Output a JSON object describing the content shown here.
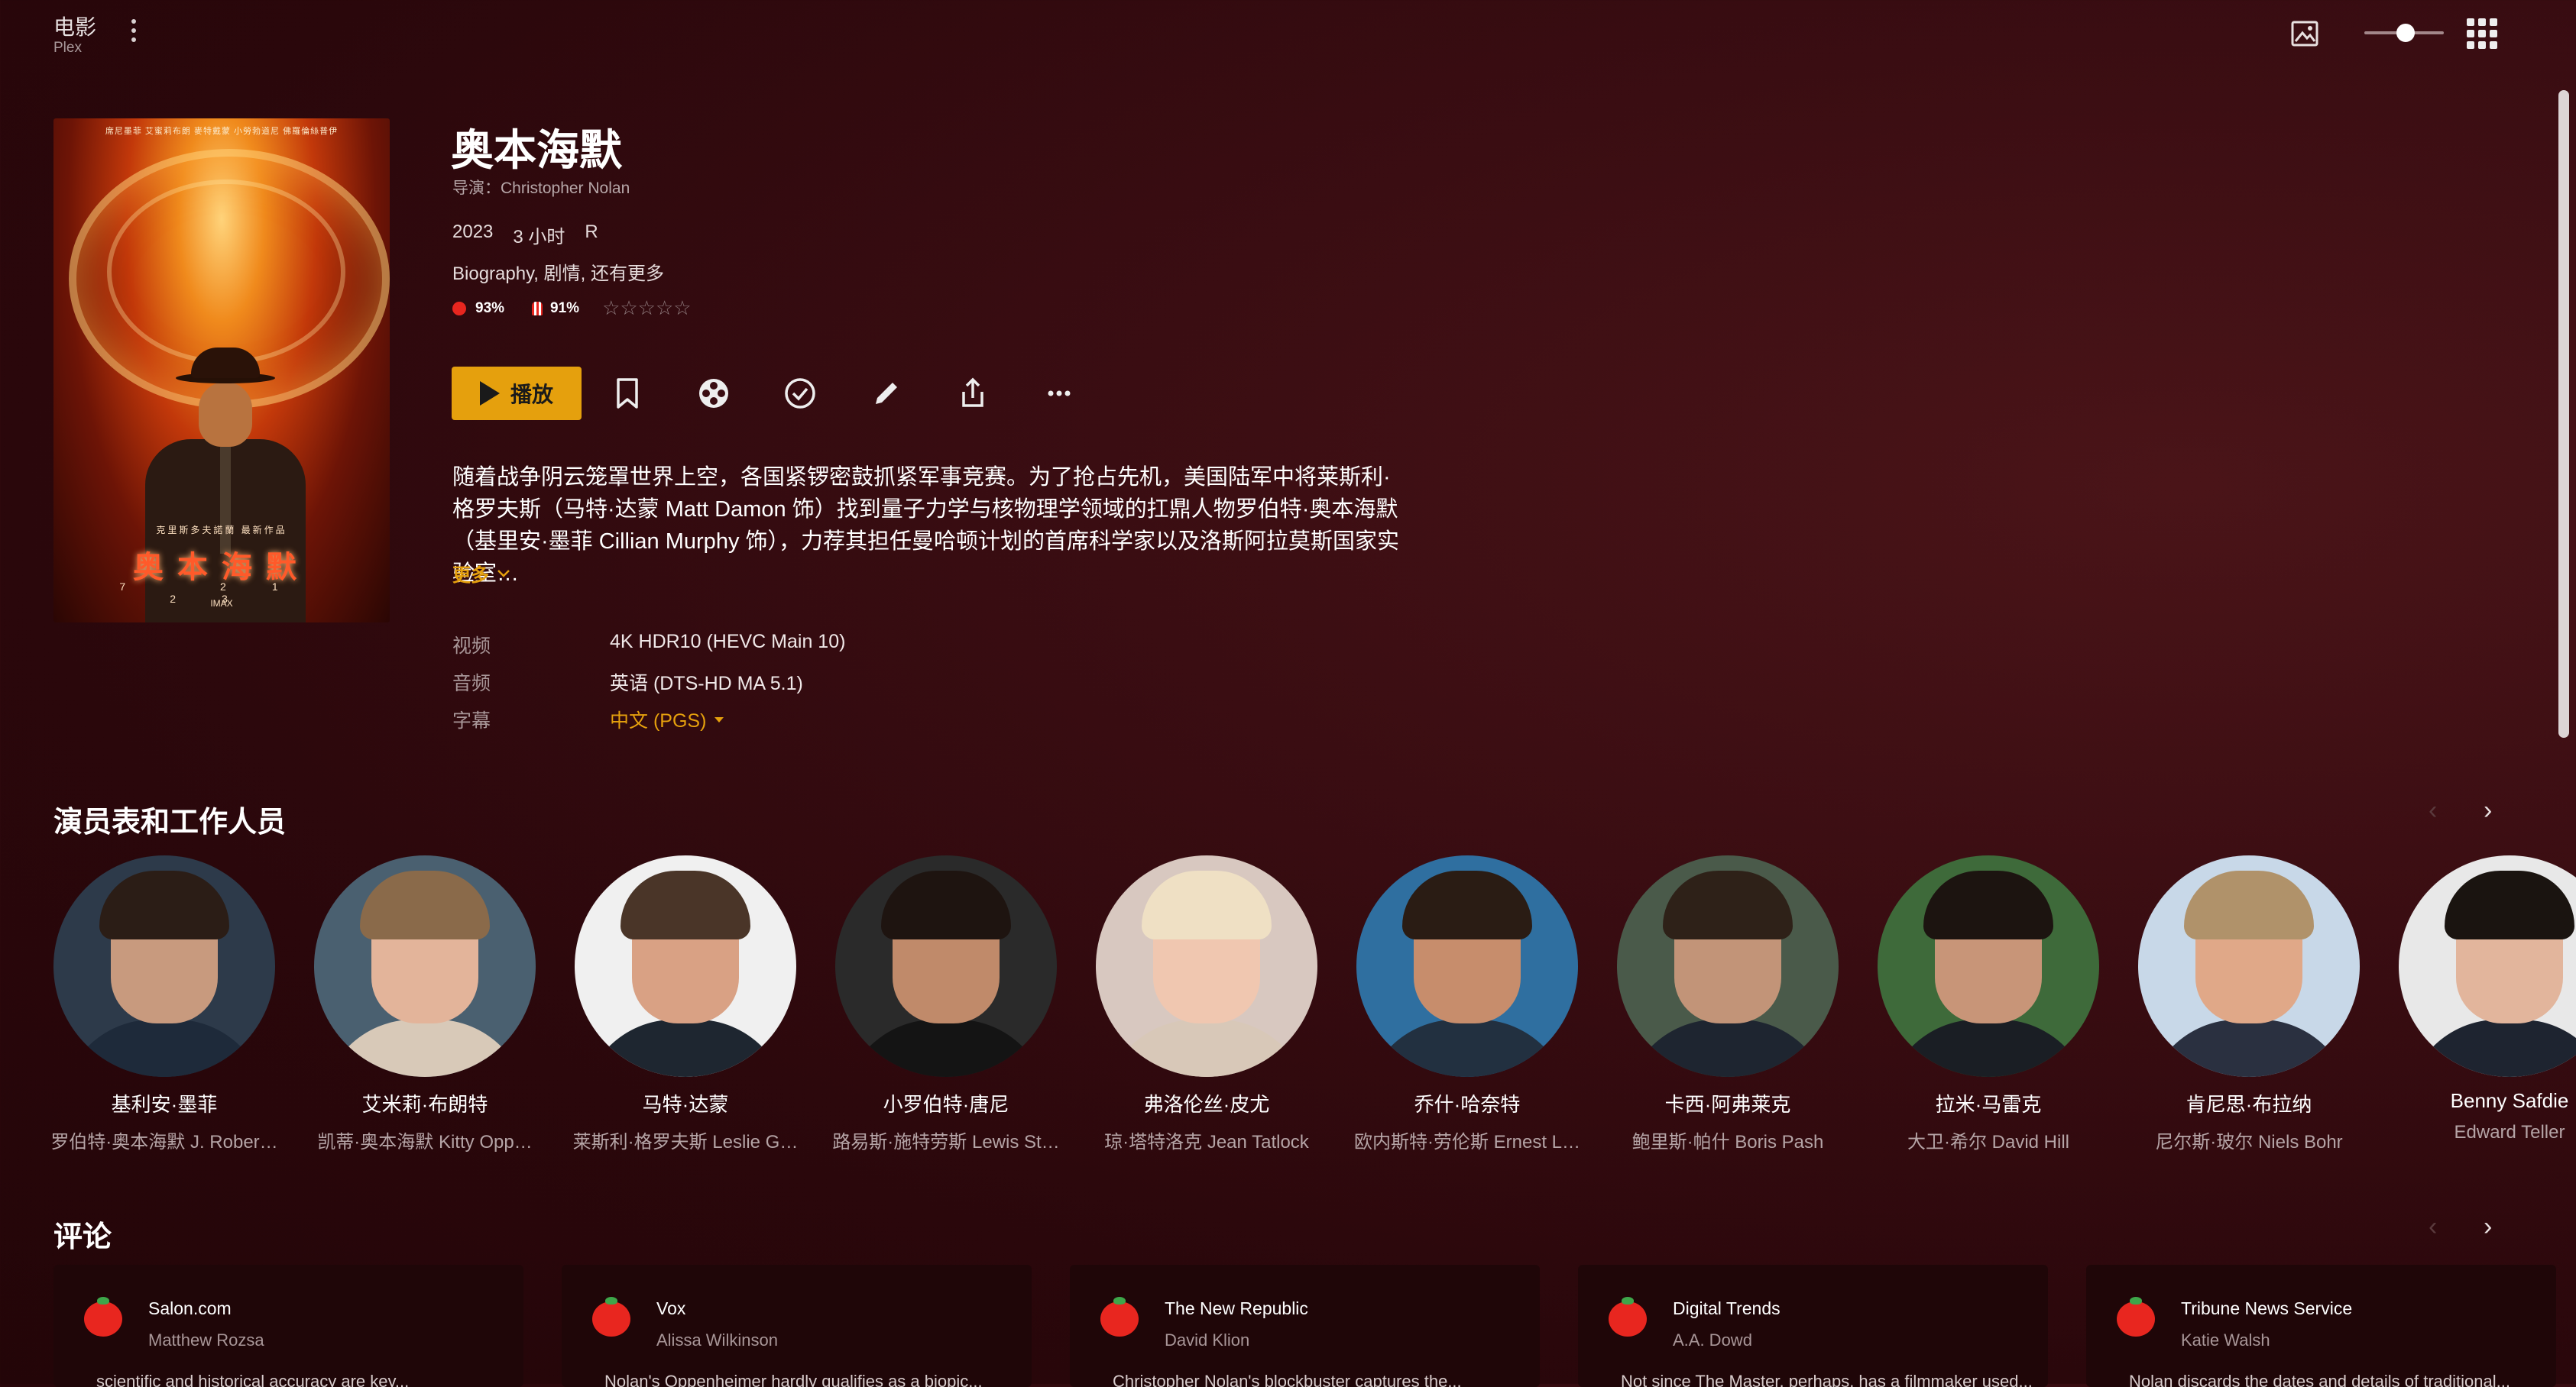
{
  "library": {
    "title": "电影",
    "subtitle": "Plex"
  },
  "colors": {
    "accent": "#e5a00d",
    "background": "#2a070b",
    "tomato": "#e8261f"
  },
  "poster": {
    "credits": "席尼墨菲  艾蜜莉布朗  麥特戴蒙  小勞勃道尼  佛羅倫絲普伊",
    "tag": "克里斯多夫諾蘭 最新作品",
    "title": "奥本海默",
    "dates": "7 21 23",
    "imax": "IMAX"
  },
  "movie": {
    "title": "奥本海默",
    "director": "导演：Christopher Nolan",
    "year": "2023",
    "duration": "3 小时",
    "rating": "R",
    "genres": "Biography, 剧情, 还有更多",
    "critic_score": "93%",
    "audience_score": "91%",
    "stars": "☆☆☆☆☆",
    "summary": "随着战争阴云笼罩世界上空，各国紧锣密鼓抓紧军事竞赛。为了抢占先机，美国陆军中将莱斯利·格罗夫斯（马特·达蒙 Matt Damon 饰）找到量子力学与核物理学领域的扛鼎人物罗伯特·奥本海默（基里安·墨菲 Cillian Murphy 饰），力荐其担任曼哈顿计划的首席科学家以及洛斯阿拉莫斯国家实验室…",
    "more": "更多"
  },
  "actions": {
    "play": "播放",
    "icons": [
      "bookmark-icon",
      "film-reel-icon",
      "check-circle-icon",
      "pencil-icon",
      "share-icon",
      "more-horizontal-icon"
    ]
  },
  "streams": {
    "video_label": "视频",
    "video_value": "4K HDR10 (HEVC Main 10)",
    "audio_label": "音频",
    "audio_value": "英语 (DTS-HD MA 5.1)",
    "subtitle_label": "字幕",
    "subtitle_value": "中文 (PGS)"
  },
  "cast_section": {
    "title": "演员表和工作人员",
    "members": [
      {
        "name": "基利安·墨菲",
        "role": "罗伯特·奥本海默 J. Rober…",
        "skin": "#c89a7e",
        "hair": "#2b1d16",
        "shirt": "#1e2a3a",
        "bg": "#2d3a4a"
      },
      {
        "name": "艾米莉·布朗特",
        "role": "凯蒂·奥本海默 Kitty Opp…",
        "skin": "#e3b49a",
        "hair": "#8a6a4a",
        "shirt": "#d8c9b8",
        "bg": "#4a6070"
      },
      {
        "name": "马特·达蒙",
        "role": "莱斯利·格罗夫斯 Leslie G…",
        "skin": "#d9a184",
        "hair": "#4a3528",
        "shirt": "#1e2630",
        "bg": "#f0f0f0"
      },
      {
        "name": "小罗伯特·唐尼",
        "role": "路易斯·施特劳斯 Lewis St…",
        "skin": "#c08a6a",
        "hair": "#1e1410",
        "shirt": "#141414",
        "bg": "#2a2a2a"
      },
      {
        "name": "弗洛伦丝·皮尤",
        "role": "琼·塔特洛克 Jean Tatlock",
        "skin": "#f0c7b0",
        "hair": "#efe0c4",
        "shirt": "#d8c8b8",
        "bg": "#d8c8c0"
      },
      {
        "name": "乔什·哈奈特",
        "role": "欧内斯特·劳伦斯 Ernest L…",
        "skin": "#c78d6c",
        "hair": "#2a1c14",
        "shirt": "#223040",
        "bg": "#2f6fa0"
      },
      {
        "name": "卡西·阿弗莱克",
        "role": "鲍里斯·帕什 Boris Pash",
        "skin": "#c29478",
        "hair": "#2e2118",
        "shirt": "#1e2530",
        "bg": "#4a5a4a"
      },
      {
        "name": "拉米·马雷克",
        "role": "大卫·希尔 David Hill",
        "skin": "#c89578",
        "hair": "#1c1410",
        "shirt": "#1a1e24",
        "bg": "#3e6a3a"
      },
      {
        "name": "肯尼思·布拉纳",
        "role": "尼尔斯·玻尔 Niels Bohr",
        "skin": "#e0a888",
        "hair": "#b0926a",
        "shirt": "#2a3040",
        "bg": "#c8d8e8"
      },
      {
        "name": "Benny Safdie",
        "role": "Edward Teller",
        "skin": "#e2b59c",
        "hair": "#1a1410",
        "shirt": "#1e2430",
        "bg": "#e8e8e8"
      }
    ]
  },
  "reviews_section": {
    "title": "评论",
    "items": [
      {
        "source": "Salon.com",
        "author": "Matthew Rozsa",
        "text": "scientific and historical accuracy are key..."
      },
      {
        "source": "Vox",
        "author": "Alissa Wilkinson",
        "text": "Nolan's Oppenheimer hardly qualifies as a biopic..."
      },
      {
        "source": "The New Republic",
        "author": "David Klion",
        "text": "Christopher Nolan's blockbuster captures the..."
      },
      {
        "source": "Digital Trends",
        "author": "A.A. Dowd",
        "text": "Not since The Master, perhaps, has a filmmaker used..."
      },
      {
        "source": "Tribune News Service",
        "author": "Katie Walsh",
        "text": "Nolan discards the dates and details of traditional..."
      }
    ]
  }
}
